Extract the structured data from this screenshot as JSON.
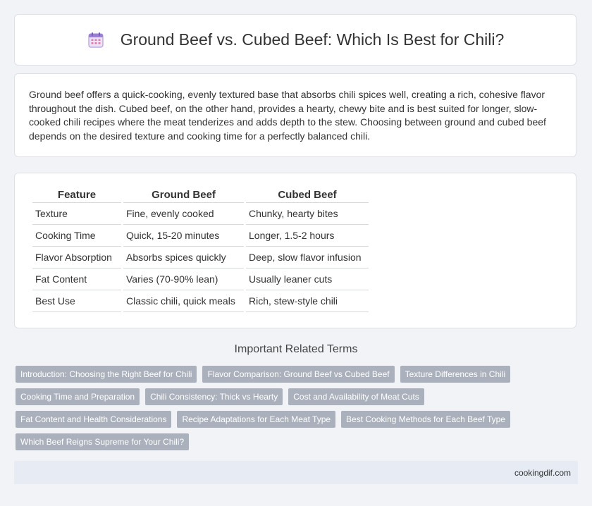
{
  "header": {
    "icon": "calendar-icon",
    "title": "Ground Beef vs. Cubed Beef: Which Is Best for Chili?"
  },
  "intro": {
    "text": "Ground beef offers a quick-cooking, evenly textured base that absorbs chili spices well, creating a rich, cohesive flavor throughout the dish. Cubed beef, on the other hand, provides a hearty, chewy bite and is best suited for longer, slow-cooked chili recipes where the meat tenderizes and adds depth to the stew. Choosing between ground and cubed beef depends on the desired texture and cooking time for a perfectly balanced chili."
  },
  "table": {
    "headers": [
      "Feature",
      "Ground Beef",
      "Cubed Beef"
    ],
    "rows": [
      [
        "Texture",
        "Fine, evenly cooked",
        "Chunky, hearty bites"
      ],
      [
        "Cooking Time",
        "Quick, 15-20 minutes",
        "Longer, 1.5-2 hours"
      ],
      [
        "Flavor Absorption",
        "Absorbs spices quickly",
        "Deep, slow flavor infusion"
      ],
      [
        "Fat Content",
        "Varies (70-90% lean)",
        "Usually leaner cuts"
      ],
      [
        "Best Use",
        "Classic chili, quick meals",
        "Rich, stew-style chili"
      ]
    ]
  },
  "terms": {
    "title": "Important Related Terms",
    "items": [
      "Introduction: Choosing the Right Beef for Chili",
      "Flavor Comparison: Ground Beef vs Cubed Beef",
      "Texture Differences in Chili",
      "Cooking Time and Preparation",
      "Chili Consistency: Thick vs Hearty",
      "Cost and Availability of Meat Cuts",
      "Fat Content and Health Considerations",
      "Recipe Adaptations for Each Meat Type",
      "Best Cooking Methods for Each Beef Type",
      "Which Beef Reigns Supreme for Your Chili?"
    ]
  },
  "footer": {
    "site": "cookingdif.com"
  }
}
